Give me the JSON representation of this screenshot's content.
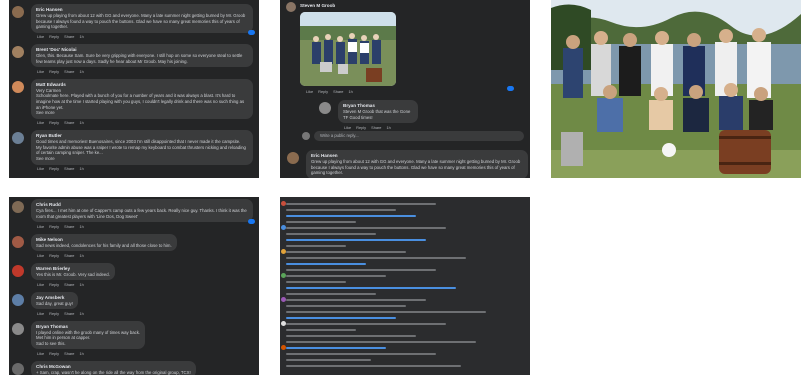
{
  "tile1": {
    "comments": [
      {
        "name": "Eric Hansen",
        "text": "Grew up playing from about 12 with GG and everyone. Many a late summer night getting burned by Mr. Groob because I always found a way to pouch the buttons. Glad we have so many great memories this of years of gaming together.",
        "actions": [
          "Like",
          "Reply",
          "Share",
          "1h"
        ],
        "avatar": "#8a6b4f"
      },
      {
        "name": "Brent 'Doc' Nicolai",
        "text": "Glen, this. Because Sam. Sure be very gripping with everyone. I still hop on some so everyone steal to settle few teams play just now a days. Sadly he hear about Mr Groob. May his joining.",
        "actions": [
          "Like",
          "Reply",
          "Share",
          "1h"
        ],
        "avatar": "#a08060"
      },
      {
        "name": "Matt Edwards",
        "text": "Very Carmen",
        "text2": "Schoolmate here. Played with a bunch of you for a number of years and it was always a blast. It's hard to imagine how at the time I started playing with you guys, I couldn't legally drink and there was no such thing as an iPhone yet.",
        "see_more": "See more",
        "actions": [
          "Like",
          "Reply",
          "Share",
          "1h"
        ],
        "avatar": "#d08a5a"
      },
      {
        "name": "Ryan Butler",
        "text": "Good times and memories! Buenosaires, since 2003 I'm still disappointed that I never made it the campsite.",
        "text2": "My favorite admin abuse was a sniper I wrote to remap my keyboard to combat thrusters nicking and reloading of certain camping sniper. The ke...",
        "see_more": "See more",
        "actions": [
          "Like",
          "Reply",
          "Share",
          "1h"
        ],
        "avatar": "#6b7f95"
      }
    ]
  },
  "tile2": {
    "poster_name": "Steven M Groob",
    "reply_name": "Bryan Thomas",
    "reply_text": "Steven M Groob that was the Gone TF Good times!",
    "write_placeholder": "Write a public reply...",
    "bottom_name": "Eric Hansen",
    "bottom_text": "Grew up playing from about 12 with GG and everyone. Many a late summer night getting burned by Mr. Groob because I always found a way to pouch the buttons. Glad we have so many great memories this of years of gaming together.",
    "actions": [
      "Like",
      "Reply",
      "Share",
      "1h"
    ]
  },
  "tile4": {
    "comments": [
      {
        "name": "Chris Rudd",
        "text": "Cya fires... I met him at one of Capper's camp outs a few years back. Really nice guy. Thanks. I think it was the room that greatest players with 'Line Dos, Dog Sweet'",
        "actions": [
          "Like",
          "Reply",
          "Share",
          "1h"
        ],
        "avatar": "#7f6a55"
      },
      {
        "name": "Mike Nelson",
        "text": "Sad news indeed, condolences for his family and all those close to him.",
        "actions": [
          "Like",
          "Reply",
          "Share",
          "1h"
        ],
        "avatar": "#a05a45"
      },
      {
        "name": "Warren Brierley",
        "text": "Yes this is Mr. Groob. Very sad indeed.",
        "actions": [
          "Like",
          "Reply",
          "Share",
          "1h"
        ],
        "avatar": "#c0392b"
      },
      {
        "name": "Jay Amsberk",
        "text": "Sad day, great guy!",
        "actions": [
          "Like",
          "Reply",
          "Share",
          "1h"
        ],
        "avatar": "#5d7ea6"
      },
      {
        "name": "Bryan Thomas",
        "text": "I played online with the groob many of times way back.",
        "text2": "Met him in person at capper.",
        "text3": "Sad to see this.",
        "actions": [
          "Like",
          "Reply",
          "Share",
          "1h"
        ],
        "avatar": "#8a8a8a"
      },
      {
        "name": "Chris McGowan",
        "text": "+ Sam, crap, wasn't he along on the ride all the way from the original group, TCX!",
        "actions": [],
        "avatar": "#6a6a6a"
      }
    ]
  },
  "tile5": {
    "lines": [
      {
        "w": 150,
        "blue": false
      },
      {
        "w": 110,
        "blue": false
      },
      {
        "w": 130,
        "blue": true
      },
      {
        "w": 70,
        "blue": false
      },
      {
        "w": 160,
        "blue": false
      },
      {
        "w": 90,
        "blue": false
      },
      {
        "w": 140,
        "blue": true
      },
      {
        "w": 60,
        "blue": false
      },
      {
        "w": 120,
        "blue": false
      },
      {
        "w": 180,
        "blue": false
      },
      {
        "w": 80,
        "blue": true
      },
      {
        "w": 150,
        "blue": false
      },
      {
        "w": 100,
        "blue": false
      },
      {
        "w": 60,
        "blue": false
      },
      {
        "w": 170,
        "blue": true
      },
      {
        "w": 90,
        "blue": false
      },
      {
        "w": 140,
        "blue": false
      },
      {
        "w": 120,
        "blue": false
      },
      {
        "w": 200,
        "blue": false
      },
      {
        "w": 110,
        "blue": true
      },
      {
        "w": 160,
        "blue": false
      },
      {
        "w": 70,
        "blue": false
      },
      {
        "w": 130,
        "blue": false
      },
      {
        "w": 190,
        "blue": false
      },
      {
        "w": 100,
        "blue": true
      },
      {
        "w": 150,
        "blue": false
      },
      {
        "w": 85,
        "blue": false
      },
      {
        "w": 175,
        "blue": false
      }
    ],
    "avatar_colors": [
      "#c94f3c",
      "#4a8fe0",
      "#e0a23a",
      "#5aa55a",
      "#9b59b6",
      "#e0e0e0",
      "#d35400"
    ]
  },
  "colors": {
    "dark_bg": "#242526",
    "bubble": "#3a3b3c",
    "accent": "#1877f2",
    "muted": "#b0b3b8"
  }
}
